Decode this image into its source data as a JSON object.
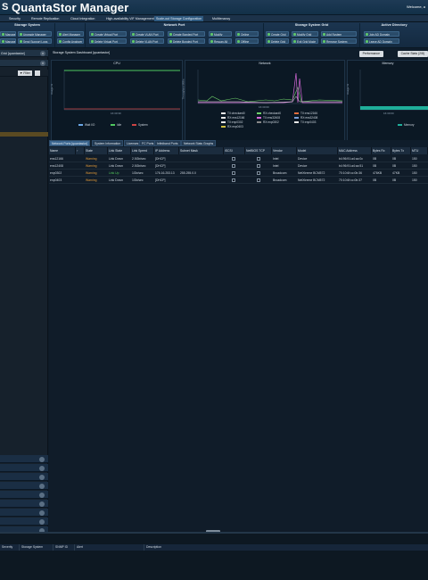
{
  "app": {
    "logo": "S",
    "title": "QuantaStor Manager",
    "welcome": "Welcome, a"
  },
  "tabs": [
    "Storage Management",
    "Security",
    "Remote Replication",
    "Cloud Integration",
    "High-availability VIF Management",
    "Scale-out Storage Configuration",
    "Multitenancy"
  ],
  "ribbon": {
    "groups": [
      {
        "title": "Storage System",
        "buttons": [
          "Manage",
          "Upgrade Manager",
          "Manage",
          "Send Support Logs"
        ]
      },
      {
        "title": "",
        "buttons": [
          "Alert Manager",
          "Config Analyzer"
        ]
      },
      {
        "title": "Network Port",
        "buttons": [
          "Create Virtual Port",
          "Delete Virtual Port",
          "Create VLAN Port",
          "Delete VLAN Port",
          "Create Bonded Port",
          "Delete Bonded Port",
          "Modify",
          "Rescan All",
          "Online",
          "Offline"
        ]
      },
      {
        "title": "Storage System Grid",
        "buttons": [
          "Create Grid",
          "Delete Grid",
          "Modify Grid",
          "Exit Grid Mode",
          "Add System",
          "Remove System"
        ]
      },
      {
        "title": "Active Directory",
        "buttons": [
          "Join AD Domain",
          "Leave AD Domain"
        ]
      }
    ]
  },
  "left_panel": {
    "header1": "Grid [quantastor]",
    "filter_label": "Filter",
    "stack_rows": 9
  },
  "dashboard": {
    "title": "Storage System Dashboard [quantastor]",
    "buttons": [
      "Performance",
      "Cache Stats (2/8)"
    ],
    "charts": [
      {
        "title": "CPU",
        "ylabel": "Usage %",
        "xtick": "16:30:30",
        "legend": [
          "Wait I/O",
          "Idle",
          "System"
        ]
      },
      {
        "title": "Network",
        "ylabel": "Throughput MB/s",
        "xtick": "16:30:00",
        "legend": [
          "TX:checkard0",
          "RX:checkard0",
          "TX:ens12166",
          "RX:ens12166",
          "TX:ens32408",
          "RX:ens32408",
          "TX:enp0302",
          "RX:enp0302",
          "TX:enp0403",
          "RX:enp0403"
        ]
      },
      {
        "title": "Memory",
        "ylabel": "Usage %",
        "xtick": "16:30:00",
        "legend": [
          "Memory"
        ]
      }
    ]
  },
  "table_tabs": [
    "Network Ports [quantastor]",
    "System Information",
    "Licenses",
    "FC Ports",
    "Infiniband Ports",
    "Network Stats Graphs"
  ],
  "table": {
    "columns": [
      "Name",
      "↑",
      "State",
      "Link State",
      "Link Speed",
      "IP Address",
      "Subnet Mask",
      "iSCSI",
      "NetBIOS TCP",
      "Vendor",
      "Model",
      "MAC Address",
      "Bytes Rx",
      "Bytes Tx",
      "MTU"
    ],
    "rows": [
      [
        "ens12166",
        "",
        "Warning",
        "Link Down",
        "2.5Gb/sec",
        "[DHCP]",
        "",
        "",
        "",
        "Intel",
        "Device",
        "b4:96:91:a4:ac:0c",
        "0B",
        "0B",
        "150"
      ],
      [
        "ens12408",
        "",
        "Warning",
        "Link Down",
        "2.5Gb/sec",
        "[DHCP]",
        "",
        "",
        "",
        "Intel",
        "Device",
        "b4:96:91:a4:ac:51",
        "0B",
        "0B",
        "150"
      ],
      [
        "enp0302",
        "",
        "Warning",
        "Link Up",
        "1Gb/sec",
        "176.16.253.13",
        "255.255.0.0",
        "",
        "",
        "Broadcom",
        "NetXtreme BCM572",
        "70:10:6f:cc:0b:36",
        "476KB",
        "47KB",
        "150"
      ],
      [
        "enp0403",
        "",
        "Warning",
        "Link Down",
        "1Gb/sec",
        "[DHCP]",
        "",
        "",
        "",
        "Broadcom",
        "NetXtreme BCM572",
        "70:10:6f:cc:0b:37",
        "0B",
        "0B",
        "150"
      ]
    ]
  },
  "bottom": {
    "columns": [
      "Severity",
      "Storage System",
      "SNMP ID",
      "Alert",
      "Description"
    ]
  },
  "colors": {
    "accent": "#2f5a80",
    "warning": "#e29a38",
    "up": "#53c95b",
    "cpu_line": "#4fc860",
    "mem_fill": "#1fae9a"
  }
}
